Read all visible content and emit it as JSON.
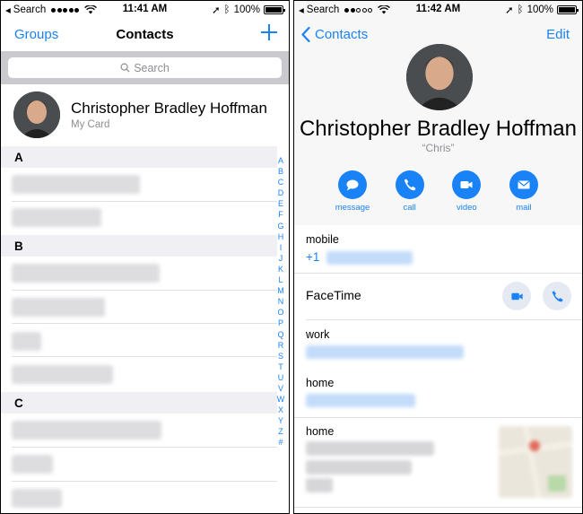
{
  "left": {
    "status": {
      "app": "Search",
      "time": "11:41 AM",
      "battery": "100%",
      "signal_filled": 5,
      "battery_level": 1.0
    },
    "nav": {
      "left_link": "Groups",
      "title": "Contacts"
    },
    "search": {
      "placeholder": "Search"
    },
    "my_card": {
      "name": "Christopher Bradley Hoffman",
      "subtitle": "My Card"
    },
    "sections": [
      "A",
      "B",
      "C"
    ],
    "index": [
      "A",
      "B",
      "C",
      "D",
      "E",
      "F",
      "G",
      "H",
      "I",
      "J",
      "K",
      "L",
      "M",
      "N",
      "O",
      "P",
      "Q",
      "R",
      "S",
      "T",
      "U",
      "V",
      "W",
      "X",
      "Y",
      "Z",
      "#"
    ]
  },
  "right": {
    "status": {
      "app": "Search",
      "time": "11:42 AM",
      "battery": "100%",
      "signal_filled": 2,
      "battery_level": 1.0
    },
    "nav": {
      "back": "Contacts",
      "edit": "Edit"
    },
    "contact": {
      "name": "Christopher Bradley Hoffman",
      "nickname": "“Chris”"
    },
    "actions": [
      {
        "label": "message",
        "icon": "message-icon"
      },
      {
        "label": "call",
        "icon": "phone-icon"
      },
      {
        "label": "video",
        "icon": "video-icon"
      },
      {
        "label": "mail",
        "icon": "mail-icon"
      }
    ],
    "fields": {
      "mobile_label": "mobile",
      "mobile_prefix": "+1",
      "facetime_label": "FaceTime",
      "work_label": "work",
      "home_email_label": "home",
      "home_address_label": "home"
    }
  },
  "colors": {
    "accent": "#1a82f7",
    "section_bg": "#efeff4",
    "search_bg": "#c9c9ce"
  }
}
